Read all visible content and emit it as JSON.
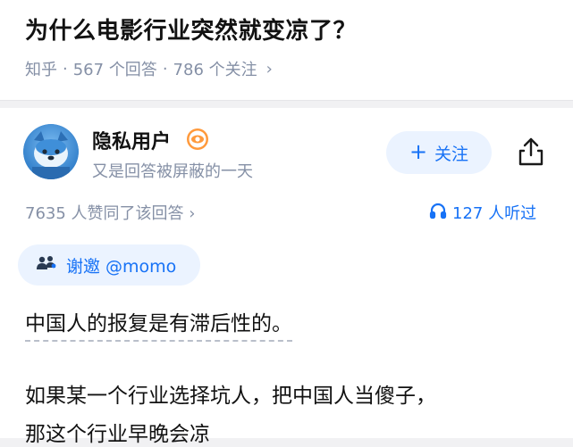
{
  "question": {
    "title": "为什么电影行业突然就变凉了？",
    "source": "知乎",
    "answers_count": "567 个回答",
    "followers_count": "786 个关注",
    "separator": "·",
    "chevron": "›"
  },
  "answer": {
    "author": {
      "name": "隐私用户",
      "bio": "又是回答被屏蔽的一天",
      "avatar_icon": "mascot-avatar-icon",
      "badge_icon": "eye-badge-icon"
    },
    "follow_button": {
      "plus": "+",
      "label": "关注"
    },
    "share_icon": "share-icon",
    "votes_text": "7635 人赞同了该回答",
    "votes_chevron": "›",
    "listen_text": "127 人听过",
    "listen_icon": "headphones-icon",
    "invite_text": "谢邀 @momo",
    "invite_icon": "people-icon",
    "paragraphs": [
      "中国人的报复是有滞后性的。",
      "如果某一个行业选择坑人，把中国人当傻子，",
      "那这个行业早晚会凉"
    ]
  },
  "colors": {
    "accent": "#1772f6",
    "accent_bg": "#ebf3ff",
    "muted": "#8590a6",
    "text": "#121212",
    "page_bg": "#f1f1f3"
  }
}
